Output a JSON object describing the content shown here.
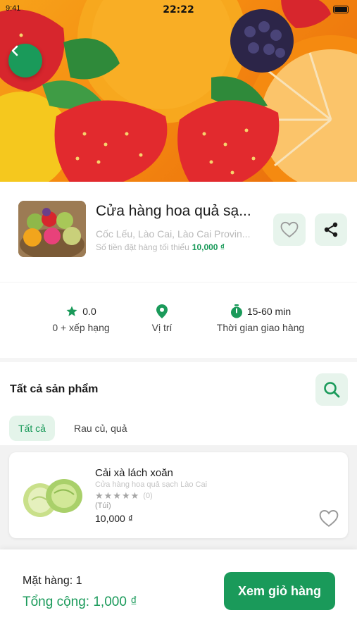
{
  "status_bar": {
    "time": "22:22",
    "left": "9:41"
  },
  "store": {
    "name": "Cửa hàng hoa quả sạ...",
    "address": "Cốc Lếu, Lào Cai, Lào Cai Provin...",
    "min_order_label": "Số tiền đặt hàng tối thiểu",
    "min_order_value": "10,000 ₫"
  },
  "stats": {
    "rating_value": "0.0",
    "rating_label": "0 + xếp hạng",
    "location_label": "Vị trí",
    "delivery_time": "15-60 min",
    "delivery_label": "Thời gian giao hàng"
  },
  "products_section": {
    "title": "Tất cả sản phẩm",
    "tabs": [
      {
        "label": "Tất cả",
        "active": true
      },
      {
        "label": "Rau củ, quả",
        "active": false
      }
    ]
  },
  "products": [
    {
      "name": "Cải xà lách xoăn",
      "store": "Cửa hàng hoa quả sạch Lào Cai",
      "stars": "★★★★★",
      "rating_count": "(0)",
      "unit": "(Túi)",
      "price": "10,000 ₫"
    }
  ],
  "cart": {
    "count_text": "Mặt hàng: 1",
    "total_text": "Tổng cộng: 1,000 ₫",
    "button_label": "Xem giỏ hàng"
  },
  "colors": {
    "accent": "#1a9a5a",
    "accent_light": "#e7f4ec",
    "muted_text": "#b9b9b9"
  },
  "icons": {
    "back": "chevron-left-icon",
    "favorite": "heart-outline-icon",
    "share": "share-icon",
    "rating": "star-icon",
    "location": "map-pin-icon",
    "delivery": "stopwatch-icon",
    "search": "search-icon"
  }
}
